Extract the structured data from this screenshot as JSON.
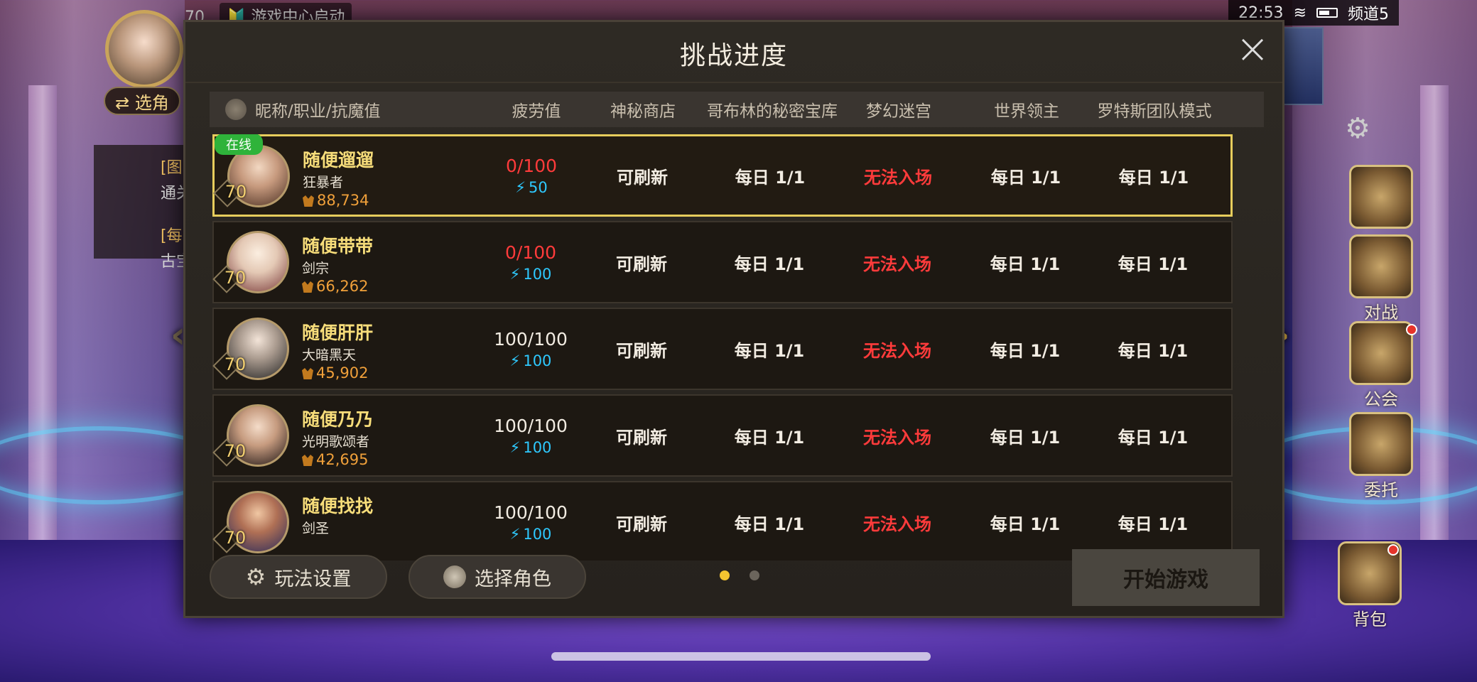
{
  "status_bar": {
    "level": "70",
    "notification": "🔰 游戏中心启动",
    "time": "22:53",
    "channel": "频道5"
  },
  "hud_left": {
    "switch_role_label": "⇄ 选角",
    "task_lines": [
      "[图",
      "通关",
      "[每",
      "古宝"
    ]
  },
  "hud_right": {
    "items": [
      {
        "label": "对战",
        "icon": "crossed-swords-icon"
      },
      {
        "label": "公会",
        "icon": "guild-emblem-icon"
      },
      {
        "label": "委托",
        "icon": "notice-board-icon"
      },
      {
        "label": "背包",
        "icon": "backpack-icon"
      }
    ]
  },
  "modal": {
    "title": "挑战进度",
    "columns": {
      "name": "昵称/职业/抗魔值",
      "fatigue": "疲劳值",
      "mystic_shop": "神秘商店",
      "goblin_vault": "哥布林的秘密宝库",
      "dream_maze": "梦幻迷宫",
      "world_lord": "世界领主",
      "rotes_raid": "罗特斯团队模式"
    },
    "rows": [
      {
        "online": "在线",
        "level": "70",
        "name": "随便遛遛",
        "class": "狂暴者",
        "power": "88,734",
        "fatigue": "0/100",
        "fatigue_red": true,
        "energy": "50",
        "mystic_shop": "可刷新",
        "goblin_vault": "每日 1/1",
        "dream_maze": "无法入场",
        "world_lord": "每日 1/1",
        "rotes_raid": "每日 1/1"
      },
      {
        "online": "",
        "level": "70",
        "name": "随便带带",
        "class": "剑宗",
        "power": "66,262",
        "fatigue": "0/100",
        "fatigue_red": true,
        "energy": "100",
        "mystic_shop": "可刷新",
        "goblin_vault": "每日 1/1",
        "dream_maze": "无法入场",
        "world_lord": "每日 1/1",
        "rotes_raid": "每日 1/1"
      },
      {
        "online": "",
        "level": "70",
        "name": "随便肝肝",
        "class": "大暗黑天",
        "power": "45,902",
        "fatigue": "100/100",
        "fatigue_red": false,
        "energy": "100",
        "mystic_shop": "可刷新",
        "goblin_vault": "每日 1/1",
        "dream_maze": "无法入场",
        "world_lord": "每日 1/1",
        "rotes_raid": "每日 1/1"
      },
      {
        "online": "",
        "level": "70",
        "name": "随便乃乃",
        "class": "光明歌颂者",
        "power": "42,695",
        "fatigue": "100/100",
        "fatigue_red": false,
        "energy": "100",
        "mystic_shop": "可刷新",
        "goblin_vault": "每日 1/1",
        "dream_maze": "无法入场",
        "world_lord": "每日 1/1",
        "rotes_raid": "每日 1/1"
      },
      {
        "online": "",
        "level": "70",
        "name": "随便找找",
        "class": "剑圣",
        "power": "",
        "fatigue": "100/100",
        "fatigue_red": false,
        "energy": "100",
        "mystic_shop": "可刷新",
        "goblin_vault": "每日 1/1",
        "dream_maze": "无法入场",
        "world_lord": "每日 1/1",
        "rotes_raid": "每日 1/1"
      }
    ],
    "footer": {
      "settings_label": "玩法设置",
      "select_role_label": "选择角色",
      "start_label": "开始游戏",
      "page_current": 1,
      "page_total": 2
    }
  },
  "colors": {
    "accent_gold": "#f7dd7a",
    "unavailable_red": "#ff3b3b",
    "energy_cyan": "#2ec9ff",
    "online_green": "#2fb33a",
    "selected_border": "#e7cd5c"
  }
}
